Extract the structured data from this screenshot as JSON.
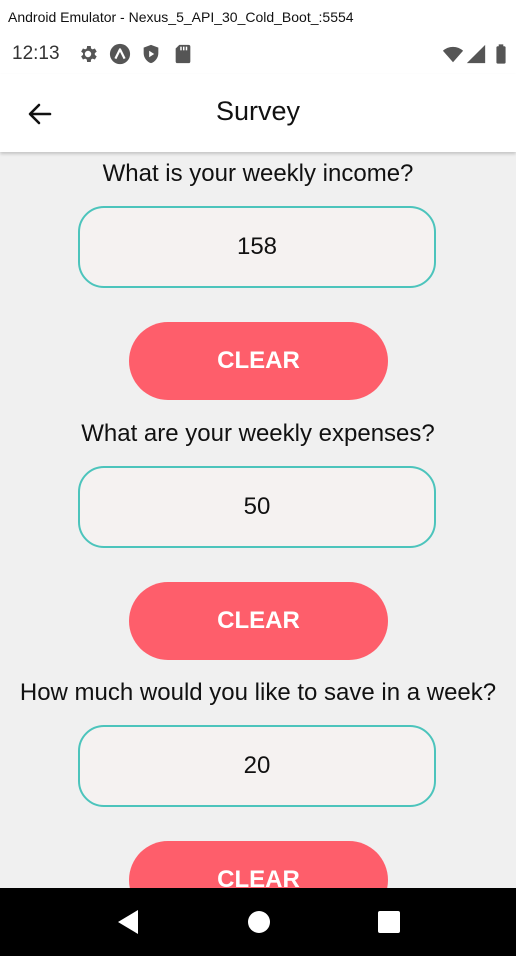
{
  "window": {
    "title": "Android Emulator - Nexus_5_API_30_Cold_Boot_:5554"
  },
  "status_bar": {
    "time": "12:13",
    "left_icons": [
      "gear-icon",
      "a-circle-icon",
      "shield-play-icon",
      "sd-card-icon"
    ],
    "right_icons": [
      "wifi-icon",
      "signal-icon",
      "battery-icon"
    ]
  },
  "app_bar": {
    "title": "Survey",
    "back_icon": "arrow-left-icon"
  },
  "survey": {
    "questions": [
      {
        "label": "What is your weekly income?",
        "value": "158",
        "clear_label": "CLEAR"
      },
      {
        "label": "What are your weekly expenses?",
        "value": "50",
        "clear_label": "CLEAR"
      },
      {
        "label": "How much would you like to save in a week?",
        "value": "20",
        "clear_label": "CLEAR"
      }
    ]
  },
  "nav_bar": {
    "buttons": [
      "back-triangle-icon",
      "home-circle-icon",
      "recents-square-icon"
    ]
  },
  "colors": {
    "accent_button": "#fe5e6b",
    "field_border": "#4cc4bc",
    "field_background": "#f5f2f1",
    "content_background": "#f0f0f0"
  }
}
